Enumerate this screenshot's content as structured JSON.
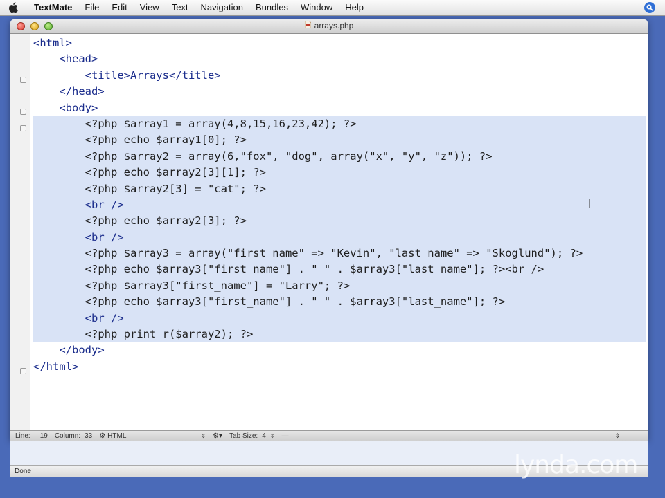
{
  "menubar": {
    "app": "TextMate",
    "items": [
      "File",
      "Edit",
      "View",
      "Text",
      "Navigation",
      "Bundles",
      "Window",
      "Help"
    ]
  },
  "window": {
    "title": "arrays.php"
  },
  "code_lines": [
    "<html>",
    "    <head>",
    "        <title>Arrays</title>",
    "    </head>",
    "    <body>",
    "        <?php $array1 = array(4,8,15,16,23,42); ?>",
    "        <?php echo $array1[0]; ?>",
    "        <?php $array2 = array(6,\"fox\", \"dog\", array(\"x\", \"y\", \"z\")); ?>",
    "        <?php echo $array2[3][1]; ?>",
    "        <?php $array2[3] = \"cat\"; ?>",
    "        <br />",
    "        <?php echo $array2[3]; ?>",
    "        <br />",
    "        <?php $array3 = array(\"first_name\" => \"Kevin\", \"last_name\" => \"Skoglund\"); ?>",
    "        <?php echo $array3[\"first_name\"] . \" \" . $array3[\"last_name\"]; ?><br />",
    "        <?php $array3[\"first_name\"] = \"Larry\"; ?>",
    "        <?php echo $array3[\"first_name\"] . \" \" . $array3[\"last_name\"]; ?>",
    "        <br />",
    "        <?php print_r($array2); ?>",
    "    </body>",
    "</html>"
  ],
  "status": {
    "line_label": "Line:",
    "line_value": "19",
    "column_label": "Column:",
    "column_value": "33",
    "language": "HTML",
    "tab_size_label": "Tab Size:",
    "tab_size_value": "4",
    "done": "Done"
  },
  "watermark": "lynda.com"
}
